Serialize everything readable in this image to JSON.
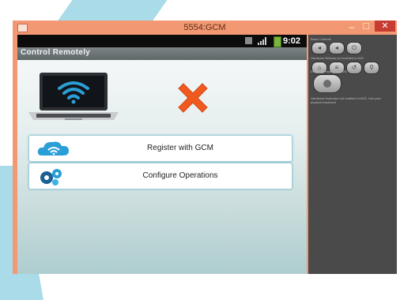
{
  "window": {
    "title": "5554:GCM",
    "controls": [
      "–",
      "☐",
      "✕"
    ]
  },
  "statusbar": {
    "time": "9:02"
  },
  "app": {
    "title": "Control Remotely"
  },
  "status_images": {
    "laptop": "laptop-wifi-icon",
    "connection": "red-x-icon"
  },
  "buttons": [
    {
      "label": "Register with GCM",
      "icon": "cloud-wifi-icon"
    },
    {
      "label": "Configure Operations",
      "icon": "gears-icon"
    }
  ],
  "emulator_panel": {
    "basic_controls_label": "Basic Controls",
    "hardware_buttons_label": "Hardware Buttons not enabled in AVD",
    "dpad_label": "DPAD not enabled in AVD",
    "hardware_keyboard_label": "Hardware Keyboard not enabled in AVD. Use your physical keyboard"
  },
  "colors": {
    "window_frame": "#f29872",
    "close_button": "#c73b30",
    "action_bar": "#6e7577",
    "accent_blue": "#2a9fd6",
    "error_red": "#f05a1e"
  }
}
